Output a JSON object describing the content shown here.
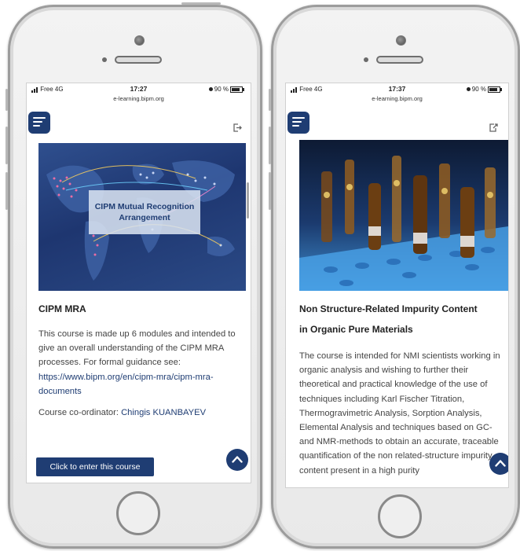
{
  "left_phone": {
    "status": {
      "carrier": "Free 4G",
      "time": "17:27",
      "battery": "90 %",
      "url": "e-learning.bipm.org"
    },
    "hero_text": "CIPM Mutual Recognition Arrangement",
    "course_title": "CIPM MRA",
    "description": "This course is made up 6 modules and intended to give an overall understanding of the CIPM MRA processes. For formal guidance see:",
    "link": "https://www.bipm.org/en/cipm-mra/cipm-mra-documents",
    "coordinator_label": "Course co-ordinator:",
    "coordinator_name": "Chingis KUANBAYEV",
    "enter_button": "Click to enter this course"
  },
  "right_phone": {
    "status": {
      "carrier": "Free 4G",
      "time": "17:37",
      "battery": "90 %",
      "url": "e-learning.bipm.org"
    },
    "course_title_line1": "Non Structure-Related Impurity Content",
    "course_title_line2": "in Organic Pure Materials",
    "description": "The course is intended for NMI scientists working in organic analysis and wishing to further their theoretical and practical knowledge of the use of techniques including Karl Fischer Titration, Thermogravimetric Analysis, Sorption Analysis, Elemental Analysis and techniques based on GC- and NMR-methods to obtain an accurate, traceable quantification of the non related-structure impurity content present in a high purity"
  },
  "colors": {
    "accent": "#1f3d73",
    "link": "#1f3d73",
    "text": "#444444"
  },
  "icons": [
    "menu-icon",
    "exit-icon",
    "chevron-up-icon"
  ]
}
